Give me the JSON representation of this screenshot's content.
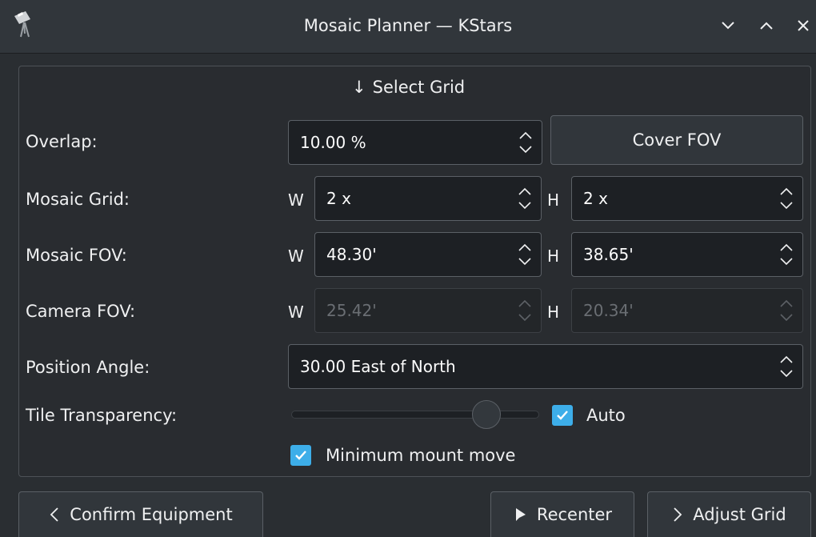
{
  "window": {
    "title": "Mosaic Planner — KStars",
    "icon": "telescope-icon"
  },
  "header": {
    "select_grid": "Select Grid",
    "arrow": "↓"
  },
  "overlap": {
    "label": "Overlap:",
    "value": "10.00 %",
    "cover_fov_button": "Cover FOV"
  },
  "mosaic_grid": {
    "label": "Mosaic Grid:",
    "w_label": "W",
    "h_label": "H",
    "w_value": "2 x",
    "h_value": "2 x"
  },
  "mosaic_fov": {
    "label": "Mosaic FOV:",
    "w_label": "W",
    "h_label": "H",
    "w_value": "48.30'",
    "h_value": "38.65'"
  },
  "camera_fov": {
    "label": "Camera FOV:",
    "w_label": "W",
    "h_label": "H",
    "w_value": "25.42'",
    "h_value": "20.34'"
  },
  "position_angle": {
    "label": "Position Angle:",
    "value": "30.00 East of North"
  },
  "tile_transparency": {
    "label": "Tile Transparency:",
    "slider_value": 0.8,
    "auto_label": "Auto",
    "auto_checked": true
  },
  "minimum_mount_move": {
    "label": "Minimum mount move",
    "checked": true
  },
  "buttons": {
    "confirm_equipment": "Confirm Equipment",
    "recenter": "Recenter",
    "adjust_grid": "Adjust Grid"
  },
  "colors": {
    "accent": "#3daee9",
    "background": "#2a2e32",
    "field": "#1d2024"
  }
}
